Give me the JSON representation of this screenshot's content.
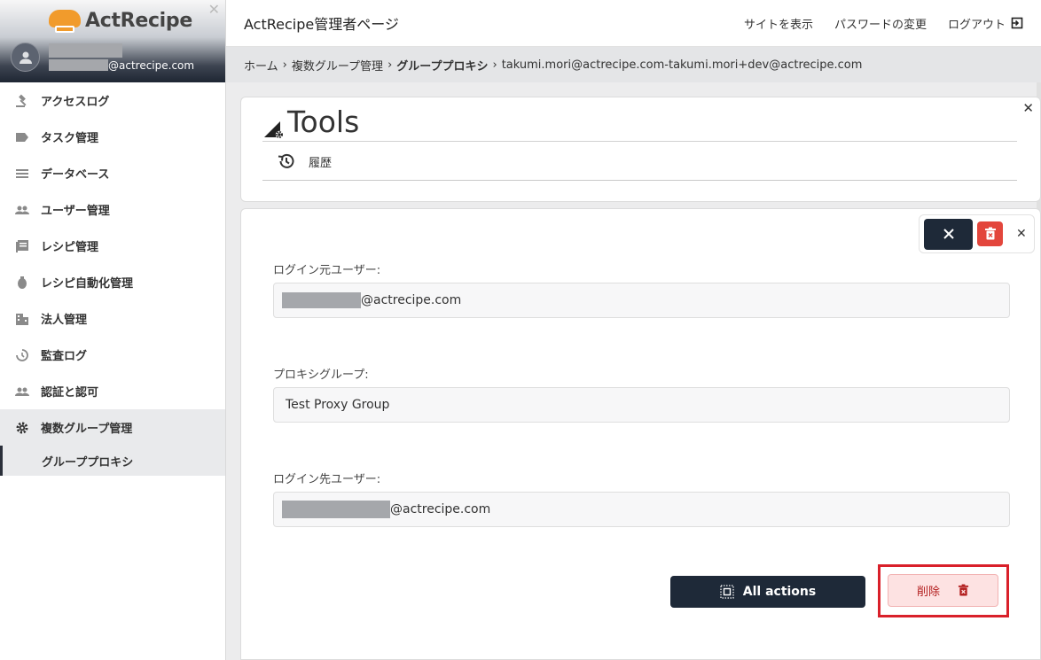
{
  "app": {
    "logo_text": "ActRecipe",
    "user_email_suffix": "@actrecipe.com"
  },
  "sidebar": {
    "items": [
      {
        "label": "アクセスログ",
        "icon": "gavel-icon"
      },
      {
        "label": "タスク管理",
        "icon": "label-icon"
      },
      {
        "label": "データベース",
        "icon": "list-icon"
      },
      {
        "label": "ユーザー管理",
        "icon": "people-icon"
      },
      {
        "label": "レシピ管理",
        "icon": "recipe-book-icon"
      },
      {
        "label": "レシピ自動化管理",
        "icon": "automation-icon"
      },
      {
        "label": "法人管理",
        "icon": "building-icon"
      },
      {
        "label": "監査ログ",
        "icon": "history-audit-icon"
      },
      {
        "label": "認証と認可",
        "icon": "people-auth-icon"
      },
      {
        "label": "複数グループ管理",
        "icon": "gear-icon"
      }
    ],
    "sub_item": "グループプロキシ"
  },
  "topbar": {
    "title": "ActRecipe管理者ページ",
    "view_site": "サイトを表示",
    "change_password": "パスワードの変更",
    "logout": "ログアウト"
  },
  "breadcrumb": {
    "home": "ホーム",
    "sep": "›",
    "multi_group": "複数グループ管理",
    "group_proxy": "グループプロキシ",
    "current": "takumi.mori@actrecipe.com-takumi.mori+dev@actrecipe.com"
  },
  "tools": {
    "heading": "Tools",
    "history": "履歴"
  },
  "form": {
    "source_user_label": "ログイン元ユーザー:",
    "source_user_suffix": "@actrecipe.com",
    "proxy_group_label": "プロキシグループ:",
    "proxy_group_value": "Test Proxy Group",
    "target_user_label": "ログイン先ユーザー:",
    "target_user_suffix": "@actrecipe.com"
  },
  "actions": {
    "all_actions": "All actions",
    "delete": "削除"
  },
  "colors": {
    "dark_button": "#1e2938",
    "danger": "#e3463c",
    "highlight": "#d9202a",
    "delete_bg": "#fde2e2"
  }
}
